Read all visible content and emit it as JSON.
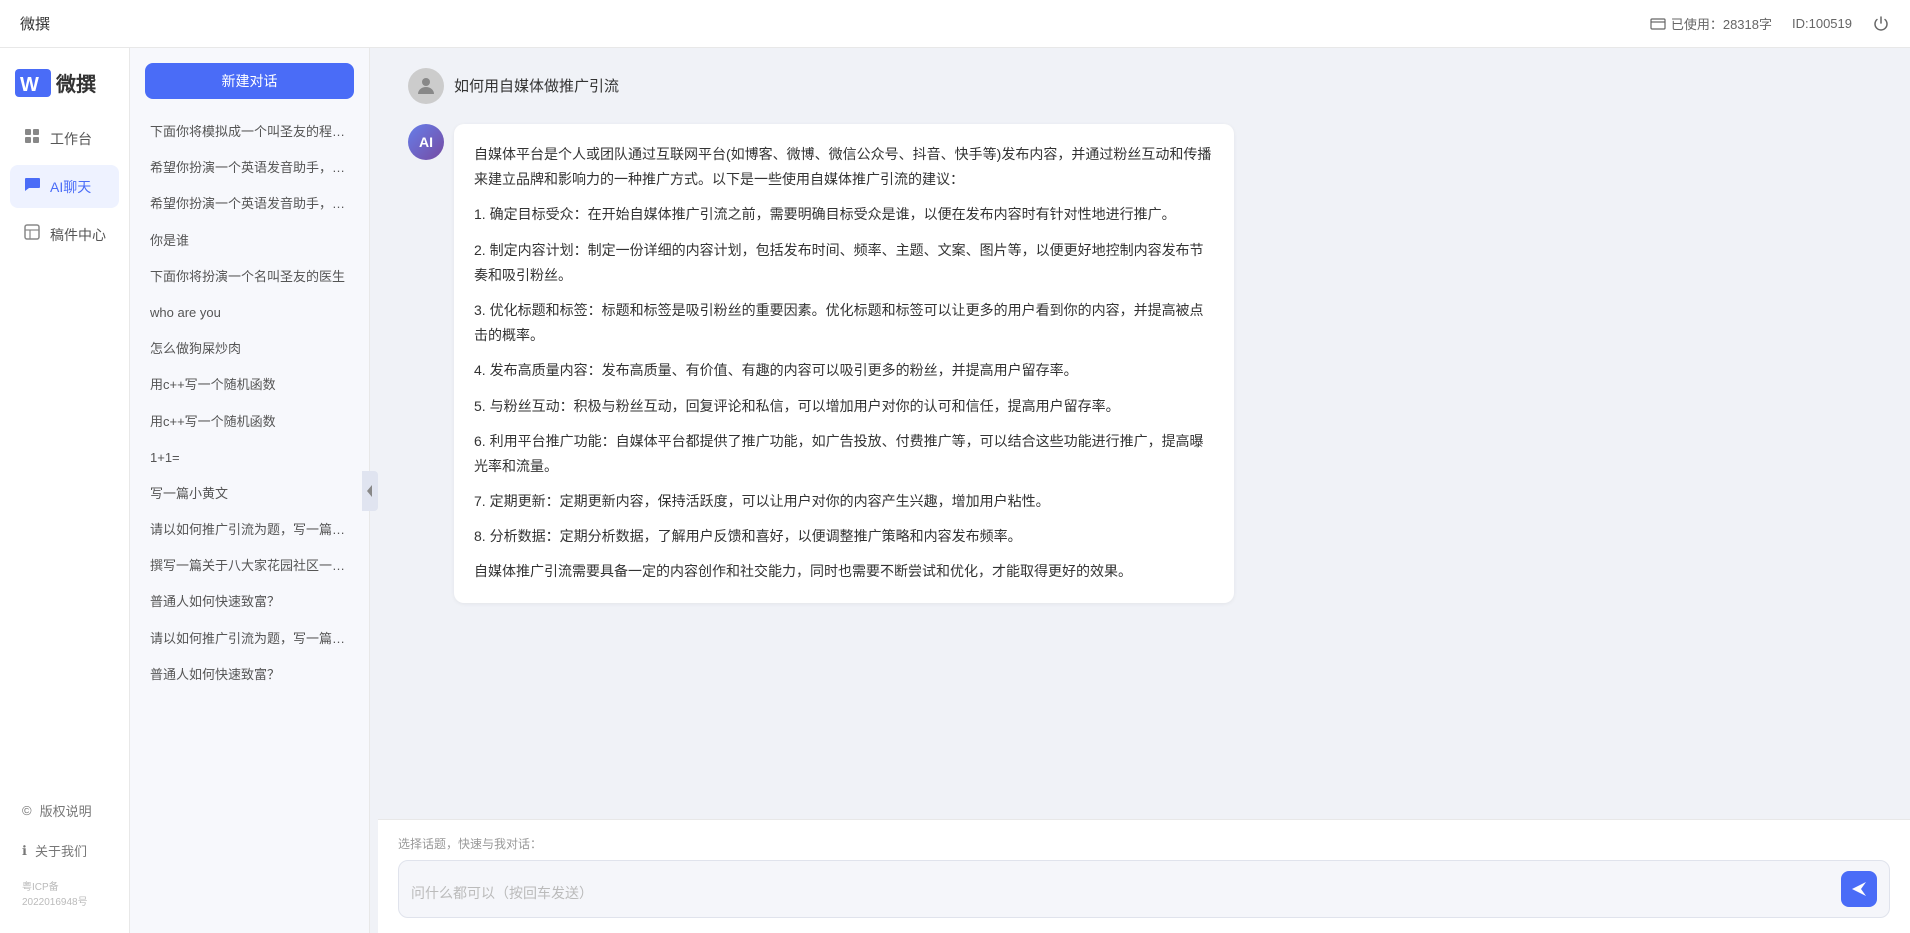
{
  "topbar": {
    "title": "微撰",
    "usage_label": "已使用：28318字",
    "id_label": "ID:100519",
    "usage_icon": "info-icon"
  },
  "nav": {
    "logo_text": "微撰",
    "items": [
      {
        "id": "workbench",
        "label": "工作台",
        "icon": "⬛"
      },
      {
        "id": "ai-chat",
        "label": "AI聊天",
        "icon": "💬",
        "active": true
      },
      {
        "id": "plugins",
        "label": "稿件中心",
        "icon": "📄"
      }
    ],
    "bottom_items": [
      {
        "id": "copyright",
        "label": "版权说明",
        "icon": "©"
      },
      {
        "id": "about",
        "label": "关于我们",
        "icon": "ℹ"
      }
    ],
    "icp": "粤ICP备2022016948号"
  },
  "history": {
    "new_chat_label": "新建对话",
    "items": [
      "下面你将模拟成一个叫圣友的程序员，我说...",
      "希望你扮演一个英语发音助手，我提供给你...",
      "希望你扮演一个英语发音助手，我提供给你...",
      "你是谁",
      "下面你将扮演一个名叫圣友的医生",
      "who are you",
      "怎么做狗屎炒肉",
      "用c++写一个随机函数",
      "用c++写一个随机函数",
      "1+1=",
      "写一篇小黄文",
      "请以如何推广引流为题，写一篇大纲",
      "撰写一篇关于八大家花园社区一刻钟便民生...",
      "普通人如何快速致富？",
      "请以如何推广引流为题，写一篇大纲",
      "普通人如何快速致富？"
    ]
  },
  "chat": {
    "user_message": "如何用自媒体做推广引流",
    "ai_response_paragraphs": [
      "自媒体平台是个人或团队通过互联网平台(如博客、微博、微信公众号、抖音、快手等)发布内容，并通过粉丝互动和传播来建立品牌和影响力的一种推广方式。以下是一些使用自媒体推广引流的建议：",
      "1. 确定目标受众：在开始自媒体推广引流之前，需要明确目标受众是谁，以便在发布内容时有针对性地进行推广。",
      "2. 制定内容计划：制定一份详细的内容计划，包括发布时间、频率、主题、文案、图片等，以便更好地控制内容发布节奏和吸引粉丝。",
      "3. 优化标题和标签：标题和标签是吸引粉丝的重要因素。优化标题和标签可以让更多的用户看到你的内容，并提高被点击的概率。",
      "4. 发布高质量内容：发布高质量、有价值、有趣的内容可以吸引更多的粉丝，并提高用户留存率。",
      "5. 与粉丝互动：积极与粉丝互动，回复评论和私信，可以增加用户对你的认可和信任，提高用户留存率。",
      "6. 利用平台推广功能：自媒体平台都提供了推广功能，如广告投放、付费推广等，可以结合这些功能进行推广，提高曝光率和流量。",
      "7. 定期更新：定期更新内容，保持活跃度，可以让用户对你的内容产生兴趣，增加用户粘性。",
      "8. 分析数据：定期分析数据，了解用户反馈和喜好，以便调整推广策略和内容发布频率。",
      "自媒体推广引流需要具备一定的内容创作和社交能力，同时也需要不断尝试和优化，才能取得更好的效果。"
    ]
  },
  "input": {
    "quick_prompt_label": "选择话题，快速与我对话：",
    "placeholder": "问什么都可以（按回车发送）",
    "send_icon": "send-icon"
  }
}
